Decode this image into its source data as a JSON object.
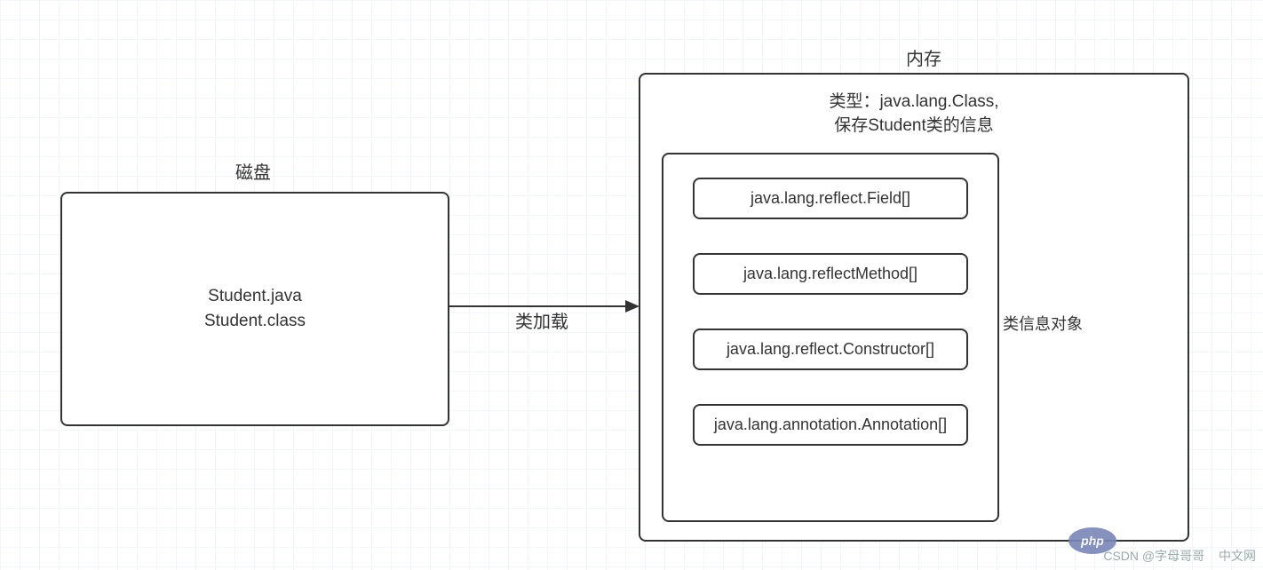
{
  "disk": {
    "title": "磁盘",
    "content_line1": "Student.java",
    "content_line2": "Student.class"
  },
  "arrow": {
    "label": "类加载"
  },
  "memory": {
    "title": "内存",
    "class_info_line1": "类型：java.lang.Class,",
    "class_info_line2": "保存Student类的信息",
    "side_label": "类信息对象",
    "items": [
      "java.lang.reflect.Field[]",
      "java.lang.reflectMethod[]",
      "java.lang.reflect.Constructor[]",
      "java.lang.annotation.Annotation[]"
    ]
  },
  "footer": {
    "watermark_left": "CSDN @字母哥哥",
    "watermark_right": "中文网",
    "php_badge": "php"
  }
}
